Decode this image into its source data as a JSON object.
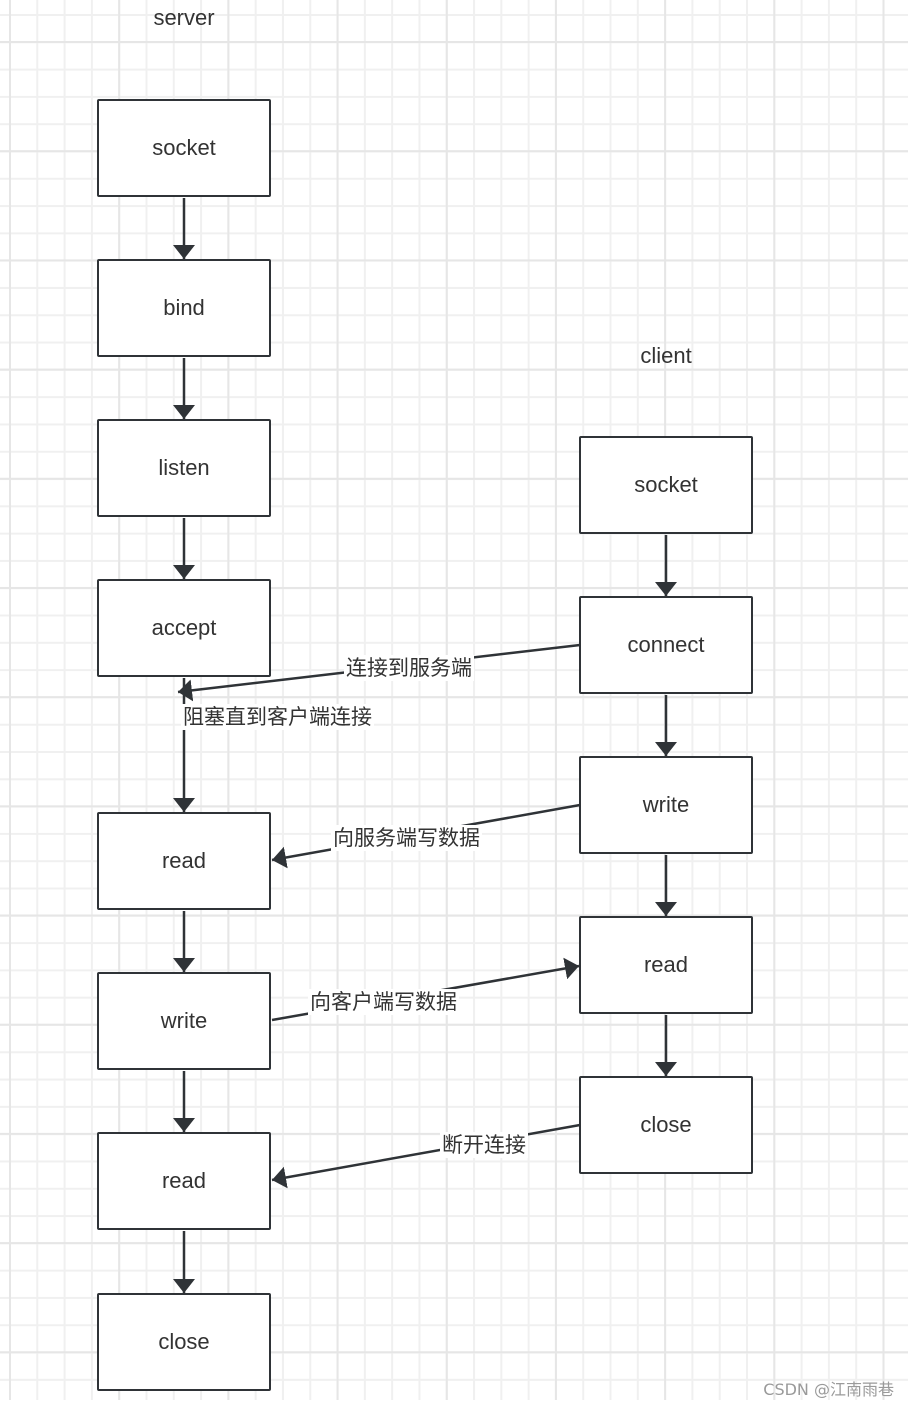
{
  "diagram": {
    "type": "flowchart",
    "lanes": {
      "server": {
        "title": "server",
        "nodes": [
          "socket",
          "bind",
          "listen",
          "accept",
          "read",
          "write",
          "read",
          "close"
        ]
      },
      "client": {
        "title": "client",
        "nodes": [
          "socket",
          "connect",
          "write",
          "read",
          "close"
        ]
      }
    },
    "cross_edges": [
      {
        "from": "client.connect",
        "to": "server.accept-to-read",
        "label": "连接到服务端"
      },
      {
        "from": "client.write",
        "to": "server.read",
        "label": "向服务端写数据"
      },
      {
        "from": "server.write",
        "to": "client.read",
        "label": "向客户端写数据"
      },
      {
        "from": "client.close",
        "to": "server.read2",
        "label": "断开连接"
      }
    ],
    "accept_note": "阻塞直到客户端连接"
  },
  "watermark": "CSDN @江南雨巷",
  "colors": {
    "stroke": "#2f3337",
    "text": "#333333",
    "grid_minor": "#f0f0f0",
    "grid_major": "#e6e6e6"
  }
}
